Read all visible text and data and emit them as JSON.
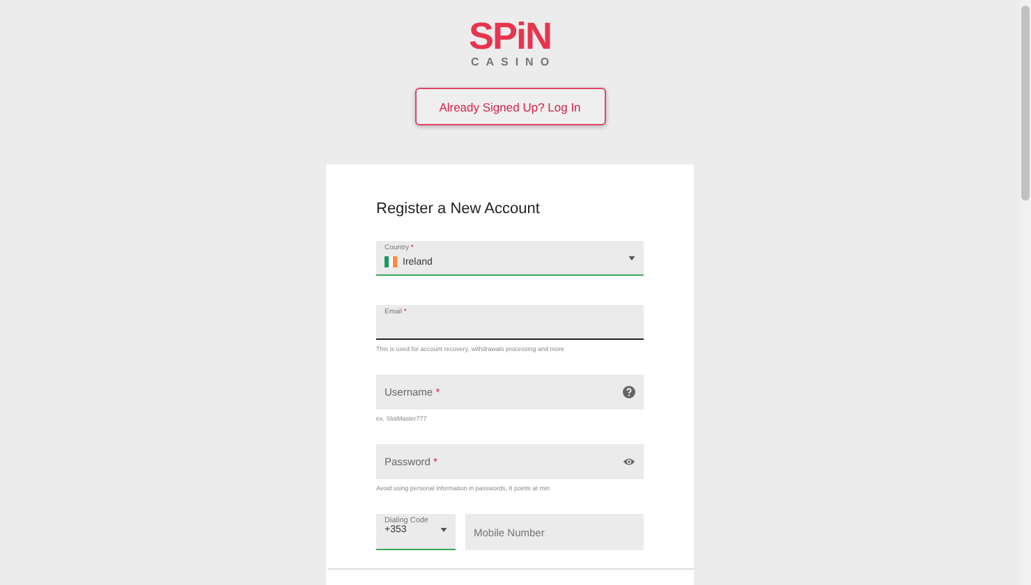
{
  "logo": {
    "word": "SPiN",
    "sub": "CASINO"
  },
  "login_button": "Already Signed Up? Log In",
  "form": {
    "title": "Register a New Account",
    "fields": [
      {
        "kind": "select",
        "label": "Country",
        "mark": "*",
        "value": "Ireland",
        "focused": true,
        "active": false
      },
      {
        "kind": "plain",
        "label": "Email",
        "mark": "*",
        "focused": false,
        "active": true,
        "hint": "This is used for account recovery, withdrawals processing and more"
      },
      {
        "kind": "help",
        "label": "Username",
        "mark": "*",
        "focused": false,
        "active": false,
        "hint": "ex. SlotMaster777"
      },
      {
        "kind": "password",
        "label": "Password",
        "mark": "*",
        "focused": false,
        "active": false,
        "hint": "Avoid using personal information in passwords, 8 points at min"
      }
    ],
    "phone": {
      "code_label": "Dialing Code",
      "code": "+353",
      "placeholder": "Mobile Number"
    }
  }
}
